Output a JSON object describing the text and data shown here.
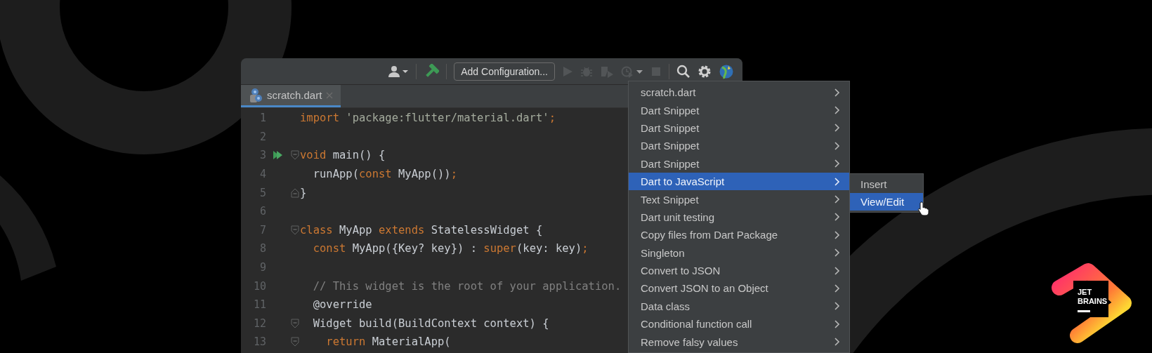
{
  "toolbar": [
    {
      "kind": "user"
    },
    {
      "kind": "build"
    },
    {
      "kind": "config",
      "label": "Add Configuration..."
    },
    {
      "kind": "run",
      "disabled": true
    },
    {
      "kind": "debug",
      "disabled": true
    },
    {
      "kind": "coverage",
      "disabled": true
    },
    {
      "kind": "profile",
      "disabled": true
    },
    {
      "kind": "stop",
      "disabled": true
    },
    {
      "kind": "search"
    },
    {
      "kind": "settings"
    },
    {
      "kind": "globe"
    }
  ],
  "tabs": [
    {
      "label": "scratch.dart",
      "selected": true
    }
  ],
  "code": [
    {
      "number": "1",
      "tokens": [
        {
          "kind": "keyword",
          "text": "import"
        },
        {
          "kind": "string",
          "text": " 'package:flutter/material.dart'"
        },
        {
          "kind": "keyword",
          "text": ";"
        }
      ]
    },
    {
      "number": "2"
    },
    {
      "number": "3",
      "run": true,
      "fold_open": true,
      "tokens": [
        {
          "kind": "keyword",
          "text": "void"
        },
        {
          "kind": "plain",
          "text": " main() {"
        }
      ]
    },
    {
      "number": "4",
      "tokens": [
        {
          "kind": "plain",
          "text": "  runApp("
        },
        {
          "kind": "keyword",
          "text": "const"
        },
        {
          "kind": "plain",
          "text": " MyApp())"
        },
        {
          "kind": "keyword",
          "text": ";"
        }
      ]
    },
    {
      "number": "5",
      "fold_close": true,
      "tokens": [
        {
          "kind": "plain",
          "text": "}"
        }
      ]
    },
    {
      "number": "6"
    },
    {
      "number": "7",
      "fold_open": true,
      "tokens": [
        {
          "kind": "keyword",
          "text": "class"
        },
        {
          "kind": "plain",
          "text": " MyApp "
        },
        {
          "kind": "keyword",
          "text": "extends"
        },
        {
          "kind": "plain",
          "text": " StatelessWidget {"
        }
      ]
    },
    {
      "number": "8",
      "tokens": [
        {
          "kind": "keyword",
          "text": "  const"
        },
        {
          "kind": "plain",
          "text": " MyApp({Key? key}) : "
        },
        {
          "kind": "keyword",
          "text": "super"
        },
        {
          "kind": "plain",
          "text": "(key: key)"
        },
        {
          "kind": "keyword",
          "text": ";"
        }
      ]
    },
    {
      "number": "9"
    },
    {
      "number": "10",
      "tokens": [
        {
          "kind": "comment",
          "text": "  // This widget is the root of your application."
        }
      ]
    },
    {
      "number": "11",
      "tokens": [
        {
          "kind": "plain",
          "text": "  @override"
        }
      ]
    },
    {
      "number": "12",
      "fold_open": true,
      "tokens": [
        {
          "kind": "plain",
          "text": "  Widget build(BuildContext context) {"
        }
      ]
    },
    {
      "number": "13",
      "fold_open": true,
      "tokens": [
        {
          "kind": "keyword",
          "text": "    return"
        },
        {
          "kind": "plain",
          "text": " MaterialApp("
        }
      ]
    }
  ],
  "menu": {
    "items": [
      {
        "label": "scratch.dart",
        "selected": false
      },
      {
        "label": "Dart Snippet",
        "selected": false
      },
      {
        "label": "Dart Snippet",
        "selected": false
      },
      {
        "label": "Dart Snippet",
        "selected": false
      },
      {
        "label": "Dart Snippet",
        "selected": false
      },
      {
        "label": "Dart to JavaScript",
        "selected": true,
        "submenu": [
          {
            "label": "Insert",
            "selected": false
          },
          {
            "label": "View/Edit",
            "selected": true
          }
        ]
      },
      {
        "label": "Text Snippet",
        "selected": false
      },
      {
        "label": "Dart unit testing",
        "selected": false
      },
      {
        "label": "Copy files from Dart Package",
        "selected": false
      },
      {
        "label": "Singleton",
        "selected": false
      },
      {
        "label": "Convert to JSON",
        "selected": false
      },
      {
        "label": "Convert JSON to an Object",
        "selected": false
      },
      {
        "label": "Data class",
        "selected": false
      },
      {
        "label": "Conditional function call",
        "selected": false
      },
      {
        "label": "Remove falsy values",
        "selected": false
      }
    ]
  },
  "logo": {
    "lines": [
      "JET",
      "BRAINS"
    ]
  }
}
